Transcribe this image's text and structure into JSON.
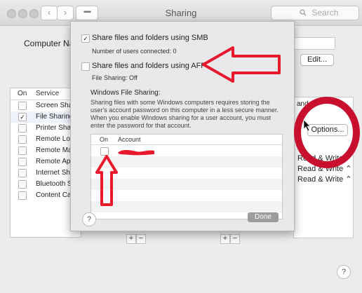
{
  "window": {
    "title": "Sharing",
    "search_placeholder": "Search"
  },
  "background": {
    "computer_name_label": "Computer Na",
    "edit_button": "Edit...",
    "services_header": {
      "on": "On",
      "service": "Service"
    },
    "services": [
      {
        "label": "Screen Sha",
        "checked": false
      },
      {
        "label": "File Sharing",
        "checked": true
      },
      {
        "label": "Printer Sha",
        "checked": false
      },
      {
        "label": "Remote Log",
        "checked": false
      },
      {
        "label": "Remote Ma",
        "checked": false
      },
      {
        "label": "Remote Ap",
        "checked": false
      },
      {
        "label": "Internet Sh",
        "checked": false
      },
      {
        "label": "Bluetooth S",
        "checked": false
      },
      {
        "label": "Content Ca",
        "checked": false
      }
    ],
    "right_header_fragment": "and",
    "options_button": "Options...",
    "permissions": [
      "Read & Write",
      "Read & Write",
      "Read & Write"
    ],
    "plus": "+",
    "minus": "−",
    "help": "?"
  },
  "sheet": {
    "smb_label": "Share files and folders using SMB",
    "smb_checked": true,
    "smb_users": "Number of users connected: 0",
    "afp_label": "Share files and folders using AFP",
    "afp_checked": false,
    "afp_status": "File Sharing: Off",
    "windows_heading": "Windows File Sharing:",
    "windows_description": "Sharing files with some Windows computers requires storing the user's account password on this computer in a less secure manner.  When you enable Windows sharing for a user account, you must enter the password for that account.",
    "table_headers": {
      "on": "On",
      "account": "Account"
    },
    "accounts": [
      {
        "checked": false,
        "name_redacted": true
      }
    ],
    "help": "?",
    "done_button": "Done"
  },
  "annotations": {
    "arrow_color": "#e8192c",
    "circle_color": "#c8102e"
  }
}
